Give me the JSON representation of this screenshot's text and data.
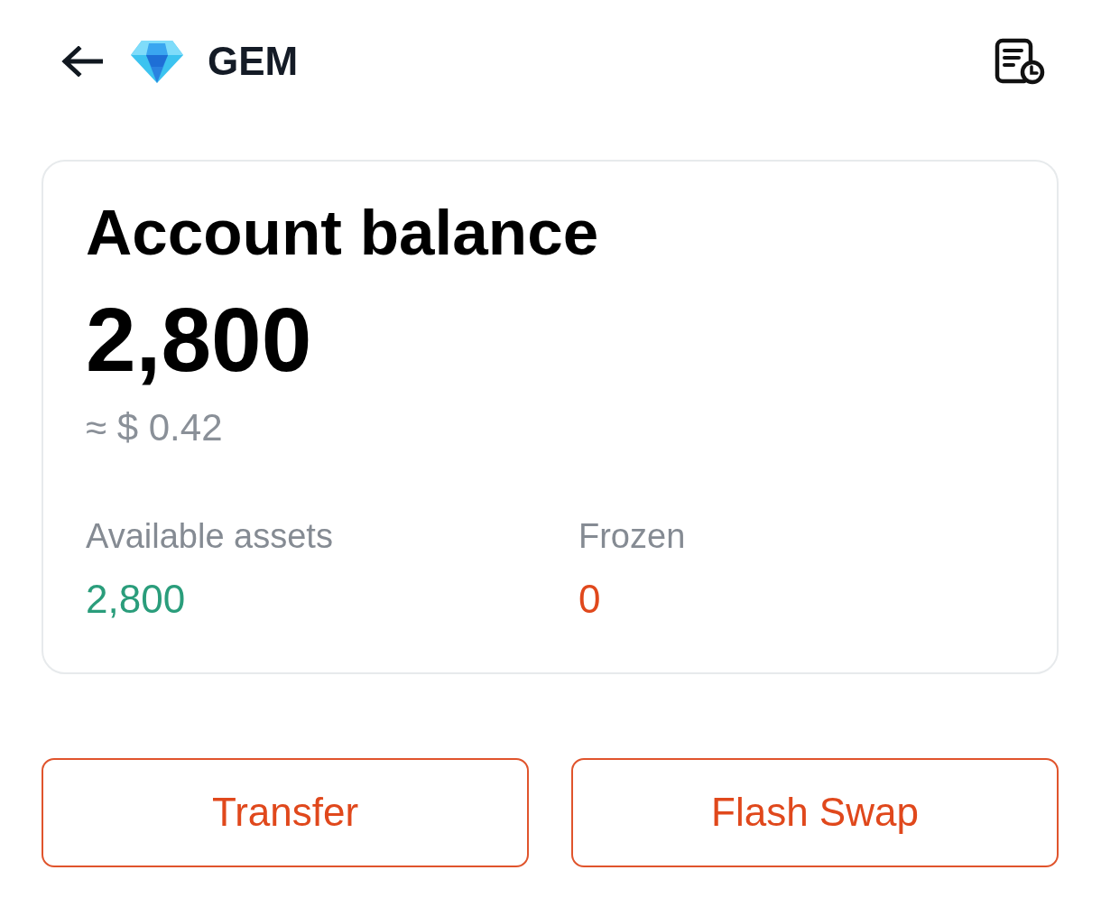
{
  "header": {
    "title": "GEM"
  },
  "balance_card": {
    "title": "Account balance",
    "amount": "2,800",
    "fiat_estimate": "≈ $ 0.42",
    "stats": [
      {
        "label": "Available assets",
        "value": "2,800",
        "color": "#2a9d7b"
      },
      {
        "label": "Frozen",
        "value": "0",
        "color": "#e0481c"
      }
    ]
  },
  "actions": [
    "Transfer",
    "Flash Swap"
  ]
}
